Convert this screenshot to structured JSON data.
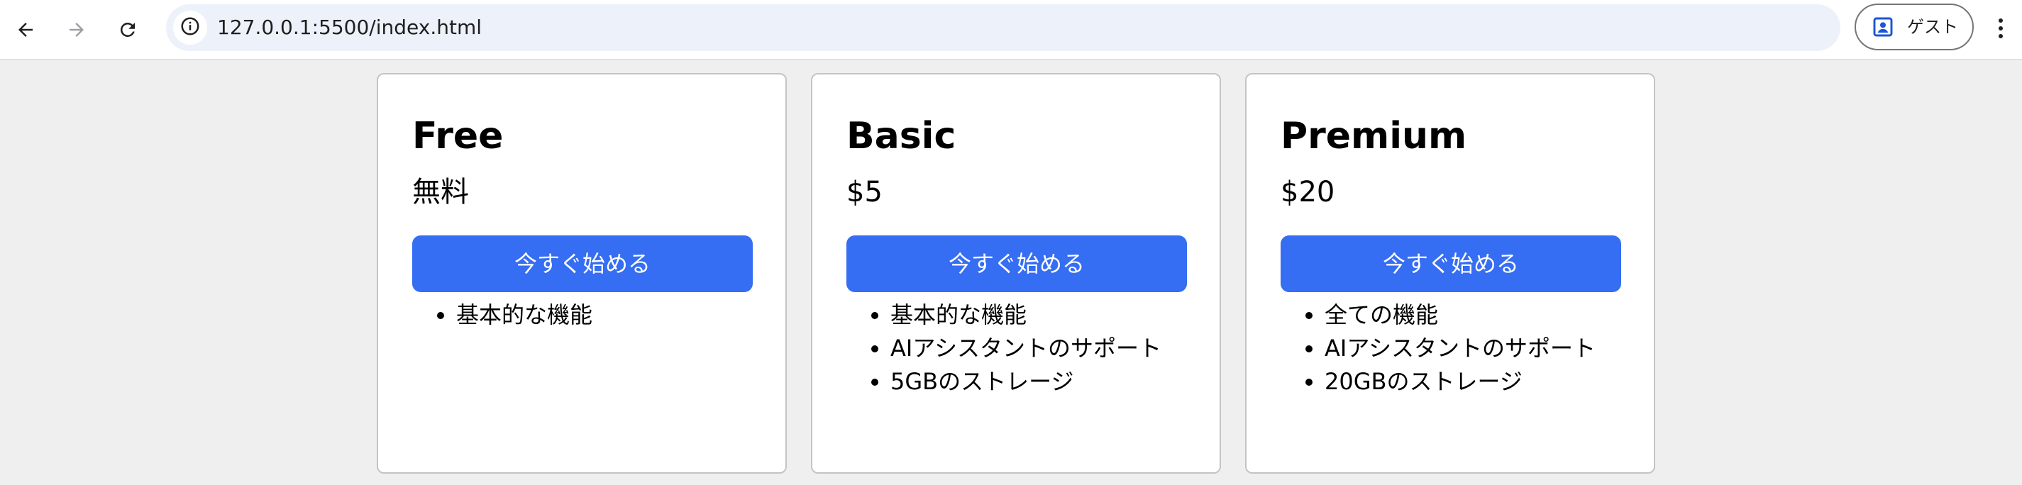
{
  "browser": {
    "url": "127.0.0.1:5500/index.html",
    "profile_label": "ゲスト",
    "icons": [
      "back-icon",
      "forward-icon",
      "reload-icon",
      "site-info-icon",
      "profile-icon",
      "more-menu-icon"
    ]
  },
  "plans": [
    {
      "title": "Free",
      "price": "無料",
      "cta_label": "今すぐ始める",
      "features": [
        "基本的な機能"
      ]
    },
    {
      "title": "Basic",
      "price": "$5",
      "cta_label": "今すぐ始める",
      "features": [
        "基本的な機能",
        "AIアシスタントのサポート",
        "5GBのストレージ"
      ]
    },
    {
      "title": "Premium",
      "price": "$20",
      "cta_label": "今すぐ始める",
      "features": [
        "全ての機能",
        "AIアシスタントのサポート",
        "20GBのストレージ"
      ]
    }
  ],
  "colors": {
    "page_background": "#efefef",
    "cta_button": "#356df3",
    "card_border": "#c4c4c4",
    "address_bar": "#edf2fa"
  }
}
